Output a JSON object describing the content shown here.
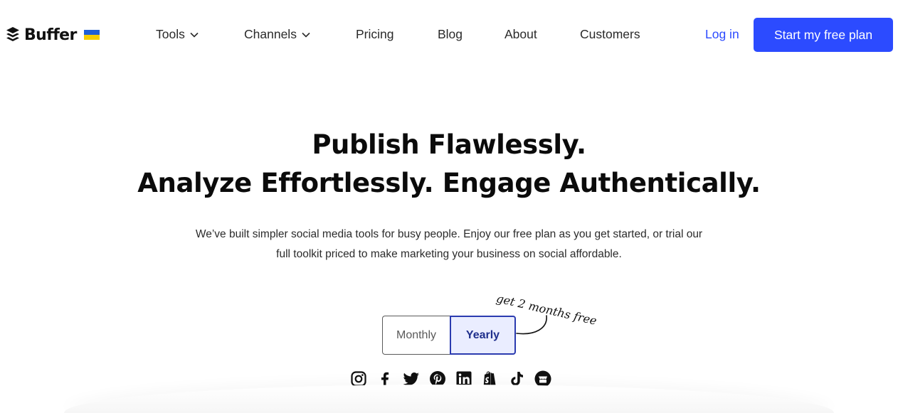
{
  "header": {
    "brand": "Buffer",
    "flag_colors": [
      "#1e5fd6",
      "#f5cd00"
    ],
    "nav": [
      {
        "label": "Tools",
        "has_dropdown": true
      },
      {
        "label": "Channels",
        "has_dropdown": true
      },
      {
        "label": "Pricing",
        "has_dropdown": false
      },
      {
        "label": "Blog",
        "has_dropdown": false
      },
      {
        "label": "About",
        "has_dropdown": false
      },
      {
        "label": "Customers",
        "has_dropdown": false
      }
    ],
    "login_label": "Log in",
    "cta_label": "Start my free plan"
  },
  "hero": {
    "title_line1": "Publish Flawlessly.",
    "title_line2": "Analyze Effortlessly. Engage Authentically.",
    "subtitle_line1": "We’ve built simpler social media tools for busy people. Enjoy our free plan as you get started, or trial our",
    "subtitle_line2": "full toolkit priced to make marketing your business on social affordable."
  },
  "billing_toggle": {
    "options": [
      "Monthly",
      "Yearly"
    ],
    "selected": "Yearly",
    "promo": "get 2 months free"
  },
  "social_icons": [
    "instagram-icon",
    "facebook-icon",
    "twitter-icon",
    "pinterest-icon",
    "linkedin-icon",
    "shopify-icon",
    "tiktok-icon",
    "google-business-icon"
  ],
  "colors": {
    "accent": "#2c4bff",
    "login": "#2c4bff",
    "yearly_bg": "#eaedff",
    "yearly_text": "#1f2f8c"
  }
}
